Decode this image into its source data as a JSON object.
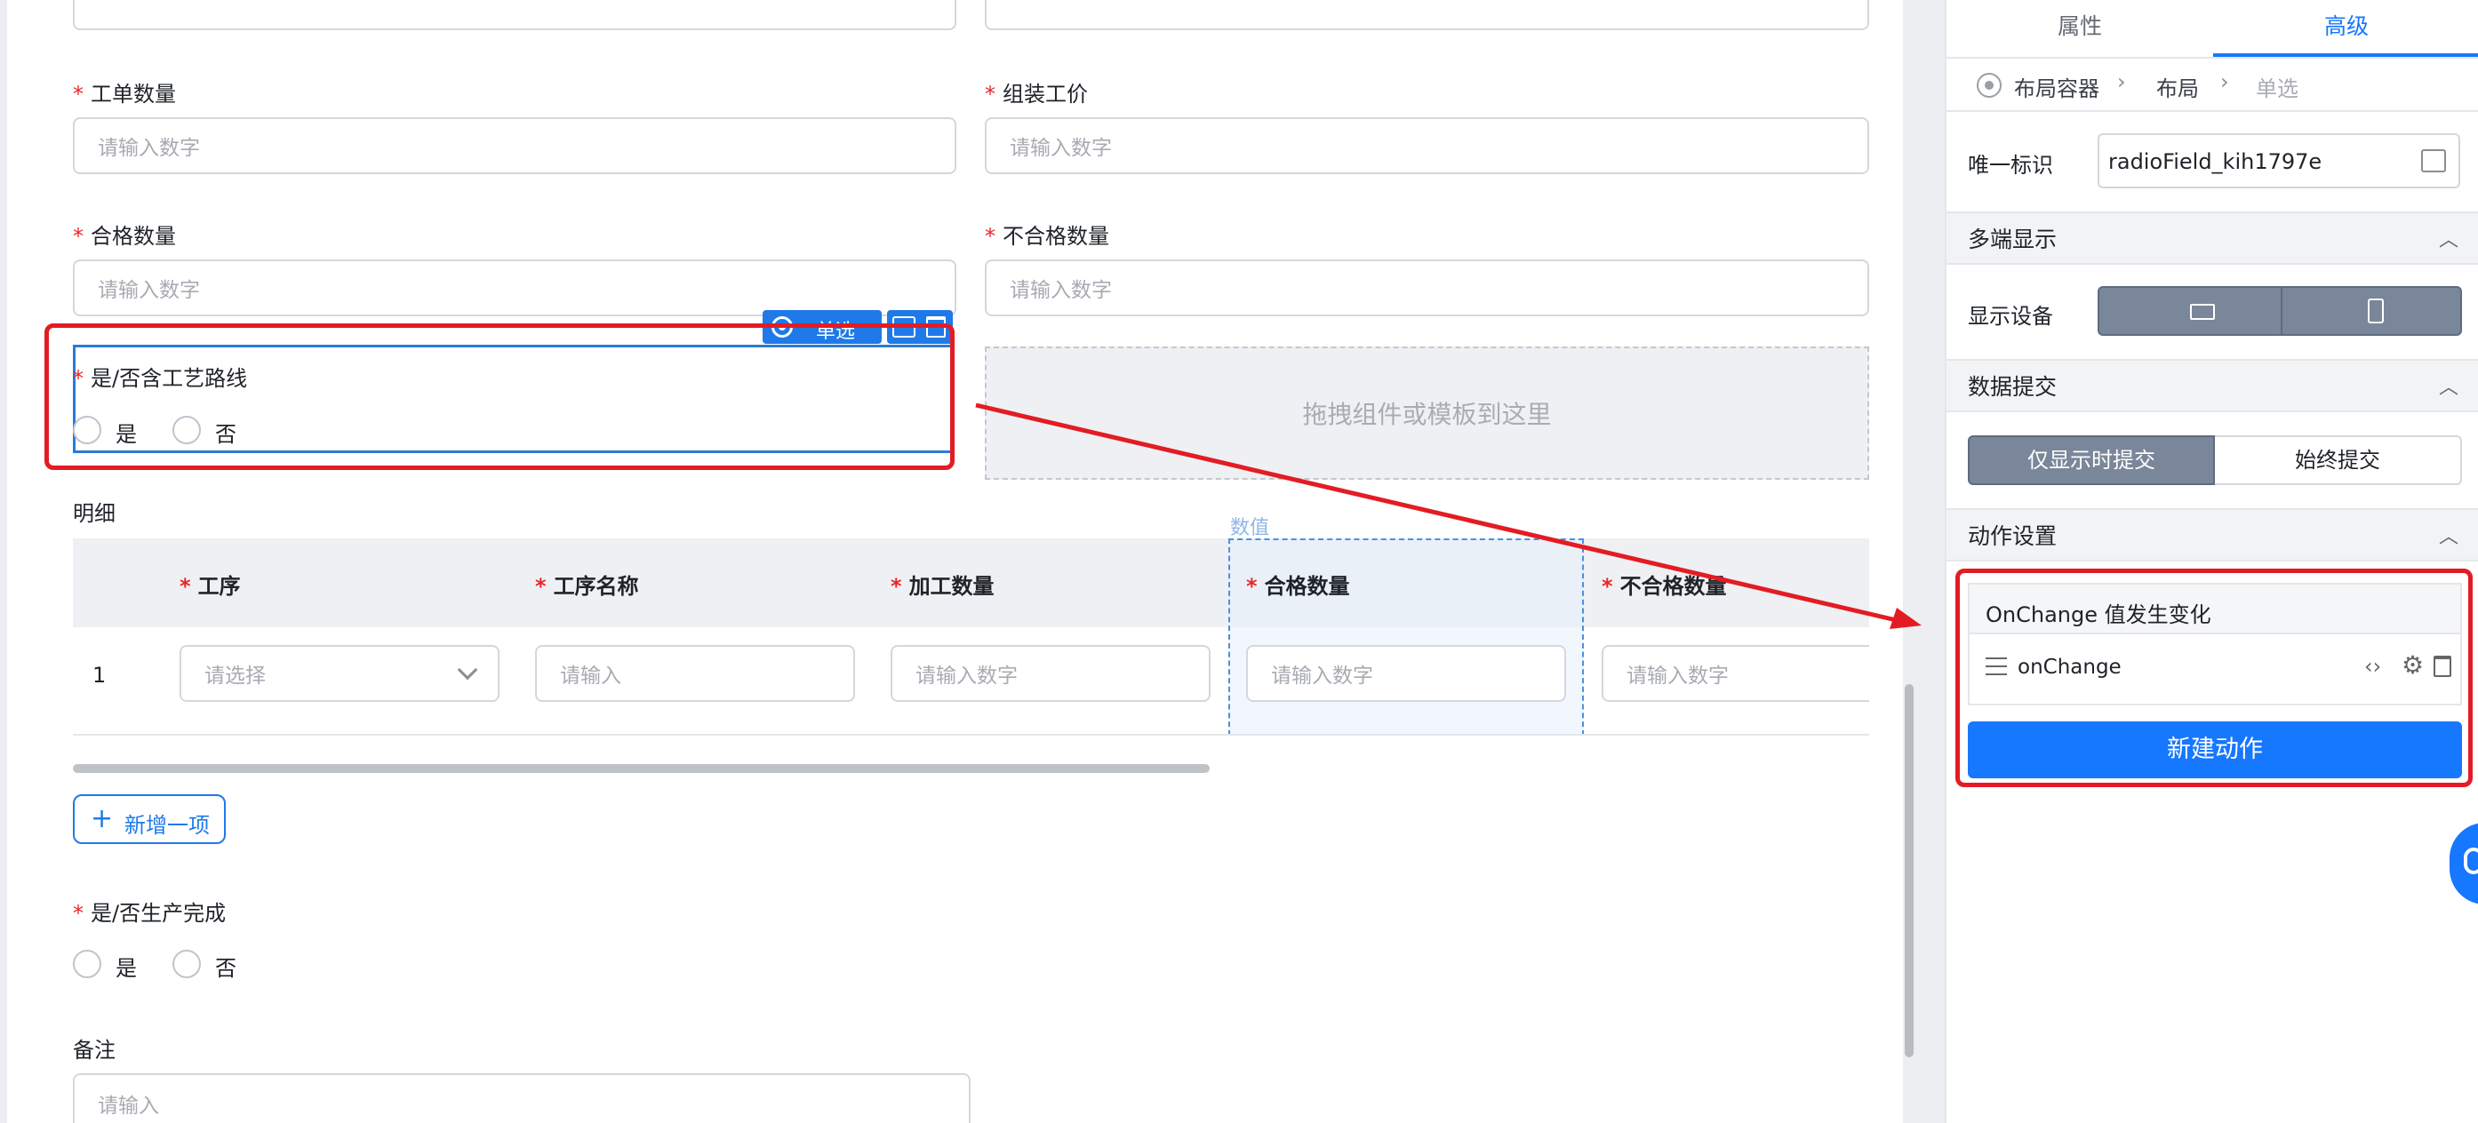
{
  "form": {
    "field1_label": "工单数量",
    "field1_placeholder": "请输入数字",
    "field2_label": "组装工价",
    "field2_placeholder": "请输入数字",
    "field3_label": "合格数量",
    "field3_placeholder": "请输入数字",
    "field4_label": "不合格数量",
    "field4_placeholder": "请输入数字",
    "radio1_label": "是/否含工艺路线",
    "radio1_yes": "是",
    "radio1_no": "否",
    "selected_tag": "单选",
    "dropzone_text": "拖拽组件或模板到这里",
    "detail_label": "明细",
    "column_hover_tag": "数值",
    "table": {
      "headers": [
        "工序",
        "工序名称",
        "加工数量",
        "合格数量",
        "不合格数量"
      ],
      "row_index": "1",
      "placeholders": [
        "请选择",
        "请输入",
        "请输入数字",
        "请输入数字",
        "请输入数字"
      ]
    },
    "add_item": "新增一项",
    "radio2_label": "是/否生产完成",
    "radio2_yes": "是",
    "radio2_no": "否",
    "remark_label": "备注",
    "remark_placeholder": "请输入"
  },
  "panel": {
    "tabs": [
      "属性",
      "高级"
    ],
    "active_tab": "高级",
    "breadcrumb": [
      "布局容器",
      "布局",
      "单选"
    ],
    "uid_label": "唯一标识",
    "uid_value": "radioField_kih1797e",
    "section_display": "多端显示",
    "device_label": "显示设备",
    "section_submit": "数据提交",
    "submit_option1": "仅显示时提交",
    "submit_option2": "始终提交",
    "section_action": "动作设置",
    "event_title": "OnChange 值发生变化",
    "event_handler": "onChange",
    "new_action": "新建动作"
  },
  "colors": {
    "primary": "#1677ff",
    "highlight_red": "#e31c24",
    "required": "#e8272a"
  }
}
